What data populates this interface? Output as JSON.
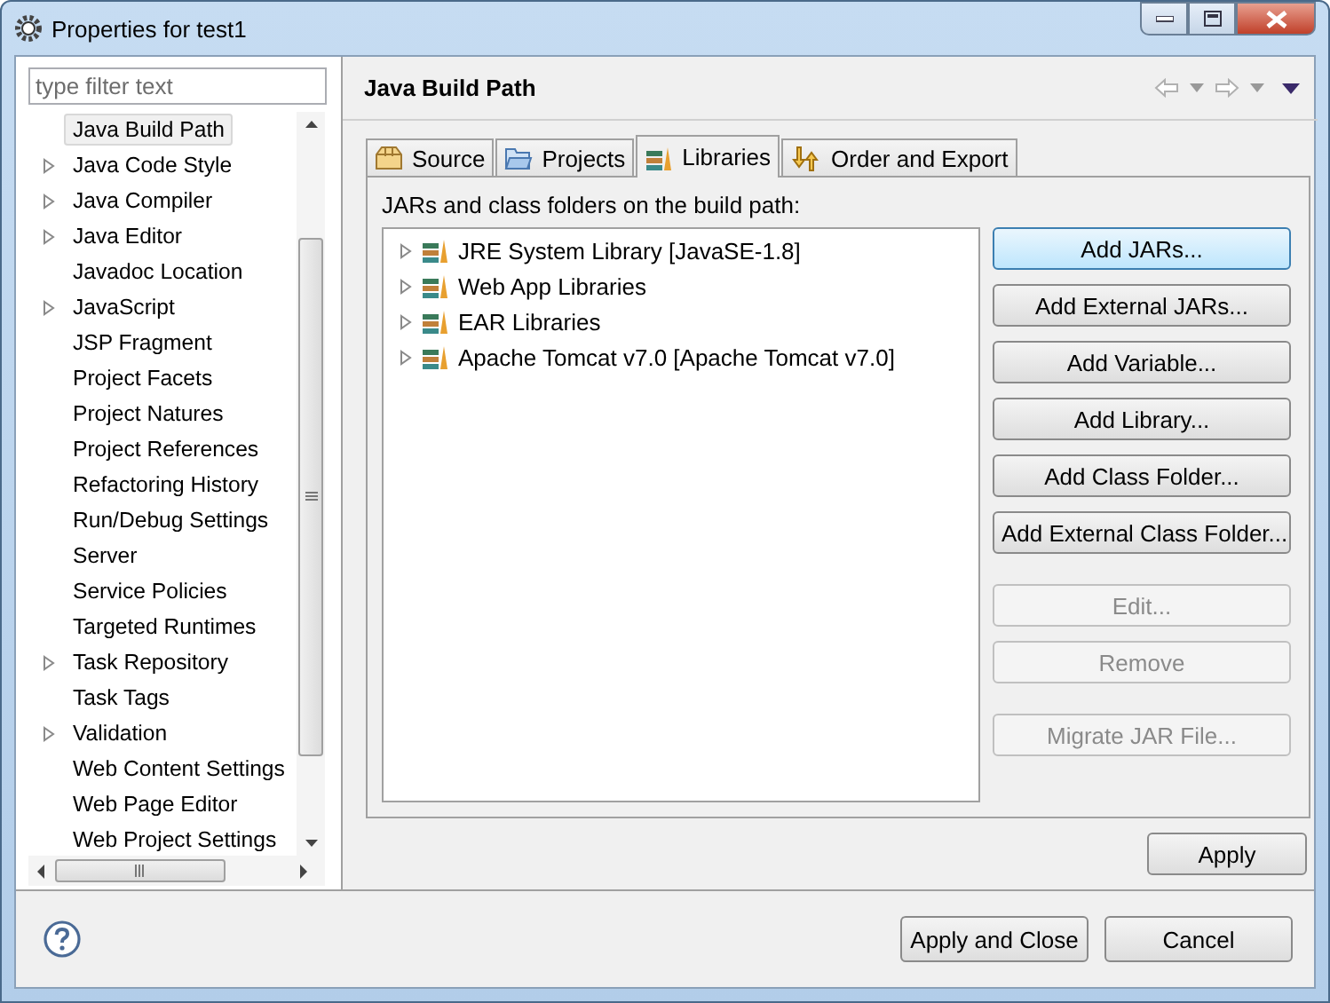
{
  "window": {
    "title": "Properties for test1"
  },
  "filter": {
    "placeholder": "type filter text"
  },
  "tree": [
    {
      "label": "Java Build Path",
      "expandable": false,
      "selected": true
    },
    {
      "label": "Java Code Style",
      "expandable": true,
      "selected": false
    },
    {
      "label": "Java Compiler",
      "expandable": true,
      "selected": false
    },
    {
      "label": "Java Editor",
      "expandable": true,
      "selected": false
    },
    {
      "label": "Javadoc Location",
      "expandable": false,
      "selected": false
    },
    {
      "label": "JavaScript",
      "expandable": true,
      "selected": false
    },
    {
      "label": "JSP Fragment",
      "expandable": false,
      "selected": false
    },
    {
      "label": "Project Facets",
      "expandable": false,
      "selected": false
    },
    {
      "label": "Project Natures",
      "expandable": false,
      "selected": false
    },
    {
      "label": "Project References",
      "expandable": false,
      "selected": false
    },
    {
      "label": "Refactoring History",
      "expandable": false,
      "selected": false
    },
    {
      "label": "Run/Debug Settings",
      "expandable": false,
      "selected": false
    },
    {
      "label": "Server",
      "expandable": false,
      "selected": false
    },
    {
      "label": "Service Policies",
      "expandable": false,
      "selected": false
    },
    {
      "label": "Targeted Runtimes",
      "expandable": false,
      "selected": false
    },
    {
      "label": "Task Repository",
      "expandable": true,
      "selected": false
    },
    {
      "label": "Task Tags",
      "expandable": false,
      "selected": false
    },
    {
      "label": "Validation",
      "expandable": true,
      "selected": false
    },
    {
      "label": "Web Content Settings",
      "expandable": false,
      "selected": false
    },
    {
      "label": "Web Page Editor",
      "expandable": false,
      "selected": false
    },
    {
      "label": "Web Project Settings",
      "expandable": false,
      "selected": false
    }
  ],
  "page": {
    "title": "Java Build Path"
  },
  "tabs": [
    {
      "label": "Source",
      "selected": false
    },
    {
      "label": "Projects",
      "selected": false
    },
    {
      "label": "Libraries",
      "selected": true
    },
    {
      "label": "Order and Export",
      "selected": false
    }
  ],
  "libraries": {
    "caption": "JARs and class folders on the build path:",
    "items": [
      "JRE System Library [JavaSE-1.8]",
      "Web App Libraries",
      "EAR Libraries",
      "Apache Tomcat v7.0 [Apache Tomcat v7.0]"
    ]
  },
  "side_buttons": [
    {
      "label": "Add JARs...",
      "disabled": false,
      "focused": true,
      "gap_before": false
    },
    {
      "label": "Add External JARs...",
      "disabled": false,
      "focused": false,
      "gap_before": false
    },
    {
      "label": "Add Variable...",
      "disabled": false,
      "focused": false,
      "gap_before": false
    },
    {
      "label": "Add Library...",
      "disabled": false,
      "focused": false,
      "gap_before": false
    },
    {
      "label": "Add Class Folder...",
      "disabled": false,
      "focused": false,
      "gap_before": false
    },
    {
      "label": "Add External Class Folder...",
      "disabled": false,
      "focused": false,
      "gap_before": false
    },
    {
      "label": "Edit...",
      "disabled": true,
      "focused": false,
      "gap_before": true
    },
    {
      "label": "Remove",
      "disabled": true,
      "focused": false,
      "gap_before": false
    },
    {
      "label": "Migrate JAR File...",
      "disabled": true,
      "focused": false,
      "gap_before": true
    }
  ],
  "apply_button": "Apply",
  "footer_buttons": [
    "Apply and Close",
    "Cancel"
  ]
}
